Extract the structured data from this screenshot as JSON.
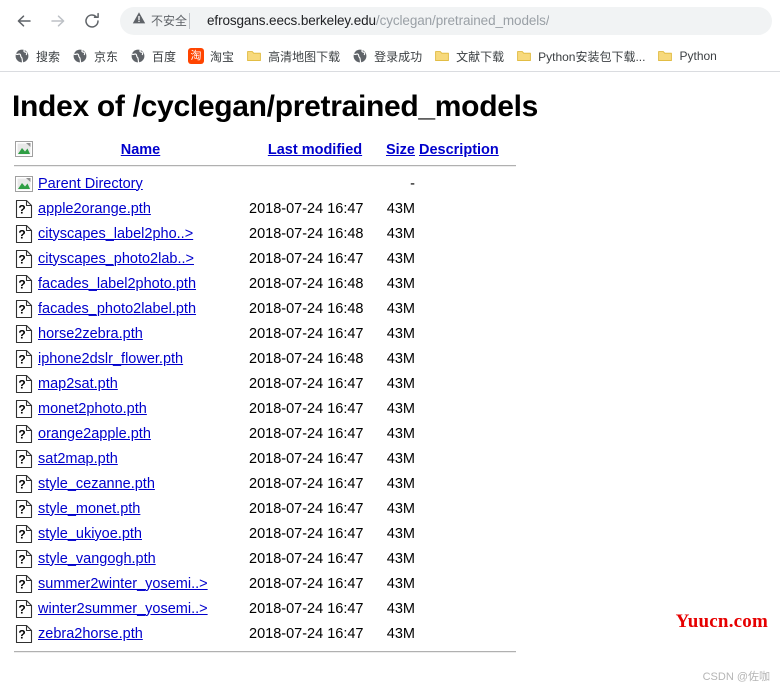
{
  "browser": {
    "nav": {
      "back_label": "Back",
      "forward_label": "Forward",
      "reload_label": "Reload"
    },
    "omnibox": {
      "security_text": "不安全",
      "security_icon": "warning-triangle-icon",
      "url_host": "efrosgans.eecs.berkeley.edu",
      "url_path": "/cyclegan/pretrained_models/",
      "url_full": "efrosgans.eecs.berkeley.edu/cyclegan/pretrained_models/"
    },
    "bookmarks": [
      {
        "label": "搜索",
        "icon": "globe-icon"
      },
      {
        "label": "京东",
        "icon": "globe-icon"
      },
      {
        "label": "百度",
        "icon": "globe-icon"
      },
      {
        "label": "淘宝",
        "icon": "taobao-icon",
        "glyph": "淘"
      },
      {
        "label": "高清地图下载",
        "icon": "folder-icon"
      },
      {
        "label": "登录成功",
        "icon": "globe-icon"
      },
      {
        "label": "文献下载",
        "icon": "folder-icon"
      },
      {
        "label": "Python安装包下载...",
        "icon": "folder-icon"
      },
      {
        "label": "Python",
        "icon": "folder-icon"
      }
    ]
  },
  "page": {
    "title": "Index of /cyclegan/pretrained_models",
    "columns": {
      "name": "Name",
      "last_modified": "Last modified",
      "size": "Size",
      "description": "Description"
    },
    "parent": {
      "label": "Parent Directory",
      "icon": "back-folder-icon",
      "last_modified": "",
      "size": "-",
      "description": ""
    },
    "rows": [
      {
        "name": "apple2orange.pth",
        "icon": "unknown-file-icon",
        "last_modified": "2018-07-24 16:47",
        "size": "43M",
        "description": ""
      },
      {
        "name": "cityscapes_label2pho..>",
        "icon": "unknown-file-icon",
        "last_modified": "2018-07-24 16:48",
        "size": "43M",
        "description": ""
      },
      {
        "name": "cityscapes_photo2lab..>",
        "icon": "unknown-file-icon",
        "last_modified": "2018-07-24 16:47",
        "size": "43M",
        "description": ""
      },
      {
        "name": "facades_label2photo.pth",
        "icon": "unknown-file-icon",
        "last_modified": "2018-07-24 16:48",
        "size": "43M",
        "description": ""
      },
      {
        "name": "facades_photo2label.pth",
        "icon": "unknown-file-icon",
        "last_modified": "2018-07-24 16:48",
        "size": "43M",
        "description": ""
      },
      {
        "name": "horse2zebra.pth",
        "icon": "unknown-file-icon",
        "last_modified": "2018-07-24 16:47",
        "size": "43M",
        "description": ""
      },
      {
        "name": "iphone2dslr_flower.pth",
        "icon": "unknown-file-icon",
        "last_modified": "2018-07-24 16:48",
        "size": "43M",
        "description": ""
      },
      {
        "name": "map2sat.pth",
        "icon": "unknown-file-icon",
        "last_modified": "2018-07-24 16:47",
        "size": "43M",
        "description": ""
      },
      {
        "name": "monet2photo.pth",
        "icon": "unknown-file-icon",
        "last_modified": "2018-07-24 16:47",
        "size": "43M",
        "description": ""
      },
      {
        "name": "orange2apple.pth",
        "icon": "unknown-file-icon",
        "last_modified": "2018-07-24 16:47",
        "size": "43M",
        "description": ""
      },
      {
        "name": "sat2map.pth",
        "icon": "unknown-file-icon",
        "last_modified": "2018-07-24 16:47",
        "size": "43M",
        "description": ""
      },
      {
        "name": "style_cezanne.pth",
        "icon": "unknown-file-icon",
        "last_modified": "2018-07-24 16:47",
        "size": "43M",
        "description": ""
      },
      {
        "name": "style_monet.pth",
        "icon": "unknown-file-icon",
        "last_modified": "2018-07-24 16:47",
        "size": "43M",
        "description": ""
      },
      {
        "name": "style_ukiyoe.pth",
        "icon": "unknown-file-icon",
        "last_modified": "2018-07-24 16:47",
        "size": "43M",
        "description": ""
      },
      {
        "name": "style_vangogh.pth",
        "icon": "unknown-file-icon",
        "last_modified": "2018-07-24 16:47",
        "size": "43M",
        "description": ""
      },
      {
        "name": "summer2winter_yosemi..>",
        "icon": "unknown-file-icon",
        "last_modified": "2018-07-24 16:47",
        "size": "43M",
        "description": ""
      },
      {
        "name": "winter2summer_yosemi..>",
        "icon": "unknown-file-icon",
        "last_modified": "2018-07-24 16:47",
        "size": "43M",
        "description": ""
      },
      {
        "name": "zebra2horse.pth",
        "icon": "unknown-file-icon",
        "last_modified": "2018-07-24 16:47",
        "size": "43M",
        "description": ""
      }
    ]
  },
  "watermarks": {
    "main": "Yuucn.com",
    "credit": "CSDN @佐咖"
  },
  "colors": {
    "link": "#0000cc",
    "visited_link": "#551a8b",
    "watermark_red": "#e60000",
    "bookmark_folder": "#f3c94b",
    "taobao_orange": "#ff4400"
  }
}
